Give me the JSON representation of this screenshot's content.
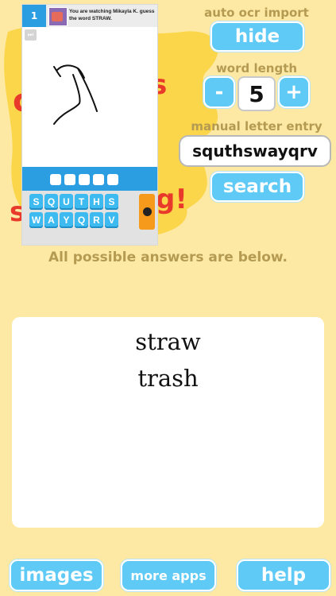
{
  "screenshot": {
    "round_number": "1",
    "notice_text": "You are watching Mikayla K. guess the word STRAW.",
    "blanks": [
      "",
      "",
      "",
      "",
      ""
    ],
    "keys_row1": [
      "S",
      "Q",
      "U",
      "T",
      "H",
      "S"
    ],
    "keys_row2": [
      "W",
      "A",
      "Y",
      "Q",
      "R",
      "V"
    ]
  },
  "ocr": {
    "label": "auto ocr import",
    "toggle_label": "hide"
  },
  "word_length": {
    "label": "word length",
    "decrement_label": "-",
    "value": "5",
    "increment_label": "+"
  },
  "letters": {
    "label": "manual letter entry",
    "value": "squthswayqrv",
    "search_label": "search"
  },
  "results": {
    "info": "All possible answers are below.",
    "answers": [
      "straw",
      "trash"
    ]
  },
  "footer": {
    "images_label": "images",
    "more_apps_label": "more apps",
    "help_label": "help"
  }
}
